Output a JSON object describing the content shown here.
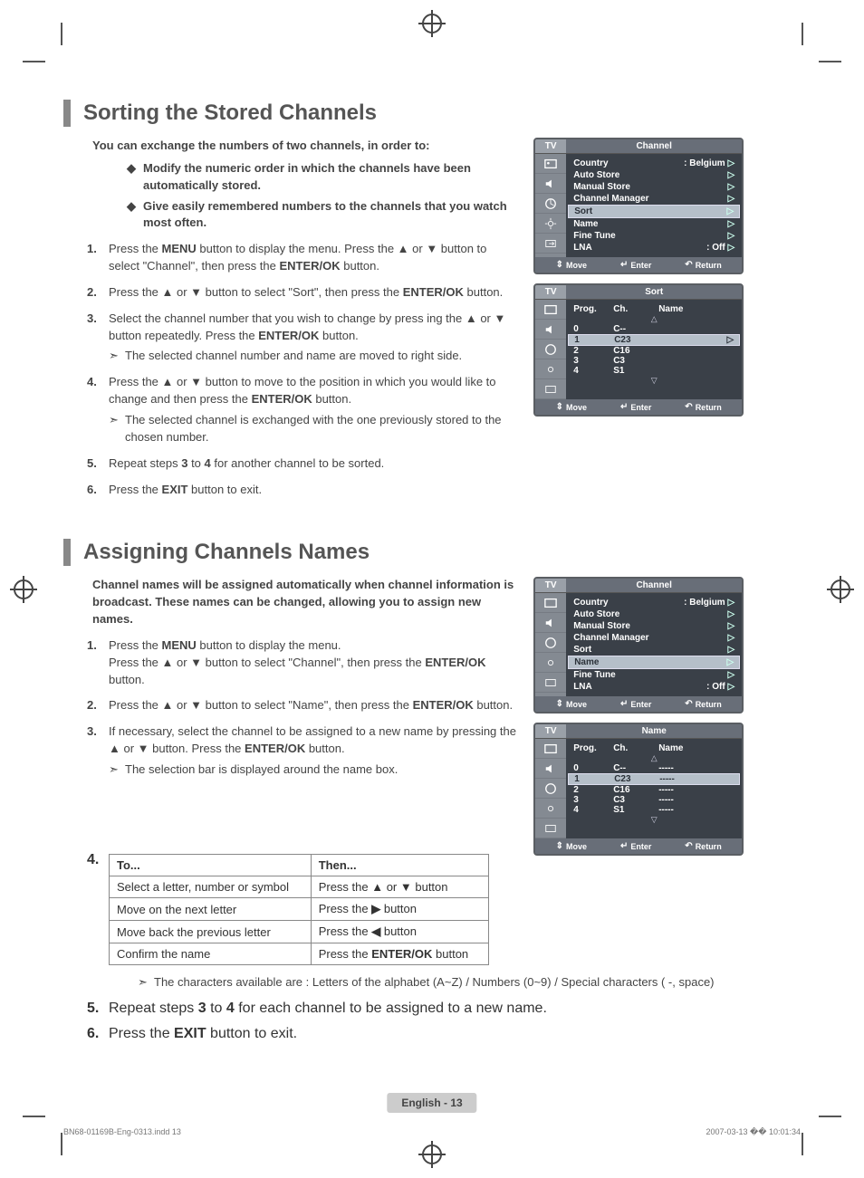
{
  "section1": {
    "title": "Sorting the Stored Channels",
    "intro": "You can exchange the numbers of two channels, in order to:",
    "bullets": [
      "Modify the numeric order in which the channels have been automatically stored.",
      "Give easily remembered numbers to the channels that you watch most often."
    ],
    "steps": {
      "s1_a": "Press the ",
      "s1_b": "MENU",
      "s1_c": " button to display the menu.  Press the ▲ or ▼ button to select \"Channel\", then press the ",
      "s1_d": "ENTER/OK",
      "s1_e": " button.",
      "s2_a": "Press the ▲ or ▼ button to select \"Sort\", then press the ",
      "s2_b": "ENTER/OK",
      "s2_c": " button.",
      "s3_a": "Select the channel number that you wish to change by press ing the ▲ or ▼ button repeatedly. Press the ",
      "s3_b": "ENTER/OK",
      "s3_c": " button.",
      "s3_sub": "The selected channel number and name are moved to right side.",
      "s4_a": "Press the ▲ or ▼ button to move to the position in which you would like to change and then press the  ",
      "s4_b": "ENTER/OK",
      "s4_c": " button.",
      "s4_sub": "The selected channel is exchanged with the one previously stored to the chosen number.",
      "s5_a": "Repeat steps ",
      "s5_b": "3",
      "s5_c": " to ",
      "s5_d": "4",
      "s5_e": " for another channel to be sorted.",
      "s6_a": "Press the ",
      "s6_b": "EXIT",
      "s6_c": " button to exit."
    }
  },
  "section2": {
    "title": "Assigning Channels Names",
    "intro": "Channel names will be assigned automatically when channel information is broadcast. These names can be changed, allowing you to assign new names.",
    "steps": {
      "s1_a": "Press the ",
      "s1_b": "MENU",
      "s1_c": " button to display the menu.",
      "s1_d": "Press the ▲ or ▼ button to select \"Channel\", then press the ",
      "s1_e": "ENTER/OK",
      "s1_f": " button.",
      "s2_a": "Press the ▲ or ▼ button to select \"Name\", then press the ",
      "s2_b": "ENTER/OK",
      "s2_c": " button.",
      "s3_a": "If necessary, select the channel to be assigned to a new name by pressing the ▲ or ▼ button. Press the ",
      "s3_b": "ENTER/OK",
      "s3_c": " button.",
      "s3_sub": "The selection bar is displayed around the name box.",
      "s4_note": "The characters available are : Letters of the alphabet (A~Z) / Numbers (0~9) / Special characters ( -, space)",
      "s5_a": "Repeat steps ",
      "s5_b": "3",
      "s5_c": " to ",
      "s5_d": "4",
      "s5_e": " for each channel to be assigned to a new name.",
      "s6_a": "Press the ",
      "s6_b": "EXIT",
      "s6_c": " button to exit."
    },
    "table": {
      "h1": "To...",
      "h2": "Then...",
      "r1a": "Select a letter, number or symbol",
      "r1b": "Press the ▲ or ▼ button",
      "r2a": "Move on the next letter",
      "r2b_a": "Press the ",
      "r2b_b": "▶",
      "r2b_c": " button",
      "r3a": "Move back the previous letter",
      "r3b_a": "Press the ",
      "r3b_b": "◀",
      "r3b_c": " button",
      "r4a": "Confirm the name",
      "r4b_a": "Press the ",
      "r4b_b": "ENTER/OK",
      "r4b_c": " button"
    }
  },
  "osd": {
    "tv": "TV",
    "channel_title": "Channel",
    "sort_title": "Sort",
    "name_title": "Name",
    "menu": {
      "country": "Country",
      "country_val": ": Belgium",
      "auto_store": "Auto Store",
      "manual_store": "Manual Store",
      "channel_manager": "Channel Manager",
      "sort": "Sort",
      "name": "Name",
      "fine_tune": "Fine Tune",
      "lna": "LNA",
      "lna_val": ": Off"
    },
    "footer": {
      "move": "Move",
      "enter": "Enter",
      "return": "Return"
    },
    "cols": {
      "prog": "Prog.",
      "ch": "Ch.",
      "name": "Name"
    },
    "sort_rows": [
      {
        "prog": "0",
        "ch": "C--",
        "name": ""
      },
      {
        "prog": "1",
        "ch": "C23",
        "name": "",
        "sel": true
      },
      {
        "prog": "2",
        "ch": "C16",
        "name": ""
      },
      {
        "prog": "3",
        "ch": "C3",
        "name": ""
      },
      {
        "prog": "4",
        "ch": "S1",
        "name": ""
      }
    ],
    "name_rows": [
      {
        "prog": "0",
        "ch": "C--",
        "name": "-----"
      },
      {
        "prog": "1",
        "ch": "C23",
        "name": "-----",
        "sel": true
      },
      {
        "prog": "2",
        "ch": "C16",
        "name": "-----"
      },
      {
        "prog": "3",
        "ch": "C3",
        "name": "-----"
      },
      {
        "prog": "4",
        "ch": "S1",
        "name": "-----"
      }
    ]
  },
  "nums": {
    "n1": "1.",
    "n2": "2.",
    "n3": "3.",
    "n4": "4.",
    "n5": "5.",
    "n6": "6."
  },
  "marker": "➣",
  "arrow": "▷",
  "page_number": "English - 13",
  "footer_left": "BN68-01169B-Eng-0313.indd   13",
  "footer_right": "2007-03-13  �� 10:01:34"
}
